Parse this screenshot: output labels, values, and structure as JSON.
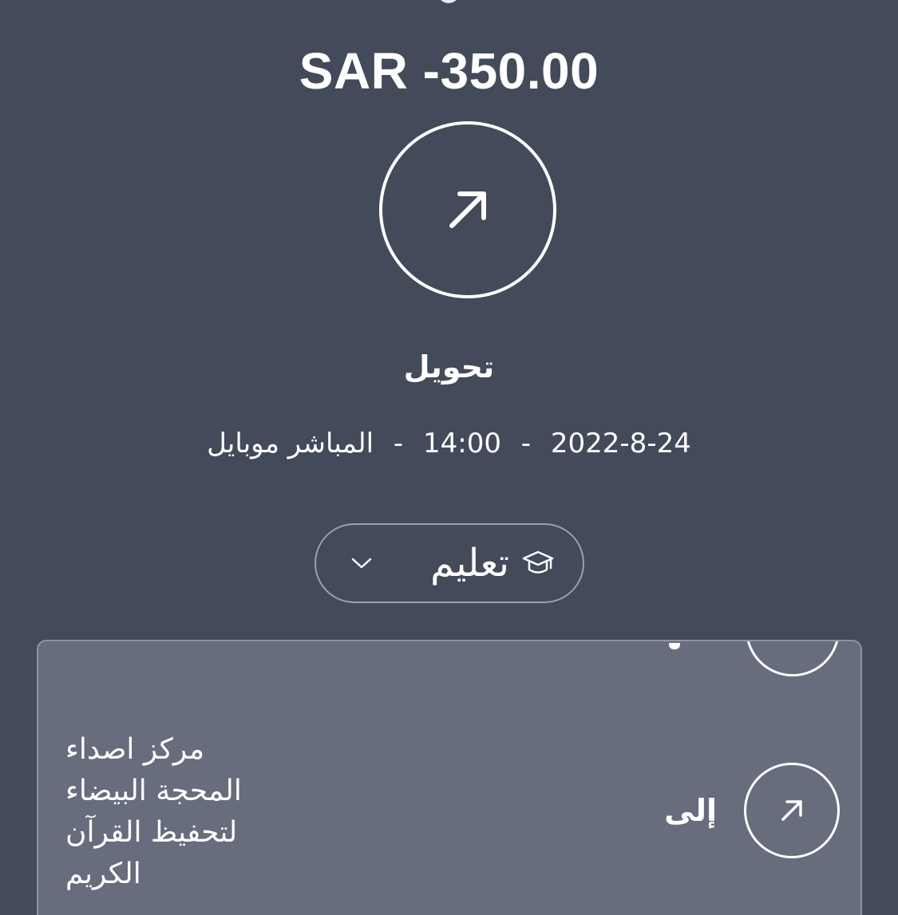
{
  "transaction": {
    "amount": "SAR -350.00",
    "type_label": "تحويل",
    "date": "2022-8-24",
    "separator": "-",
    "time": "14:00",
    "channel": "المباشر موبايل"
  },
  "category": {
    "label": "تعليم",
    "icon": "graduation-cap-icon",
    "chevron_icon": "chevron-down-icon"
  },
  "details": {
    "to_label": "إلى",
    "recipient_lines": [
      "مركز اصداء",
      "المحجة البيضاء",
      "لتحفيظ القرآن",
      "الكريم"
    ]
  },
  "colors": {
    "background": "#434a5a",
    "card": "#676d7c",
    "text": "#ffffff"
  }
}
